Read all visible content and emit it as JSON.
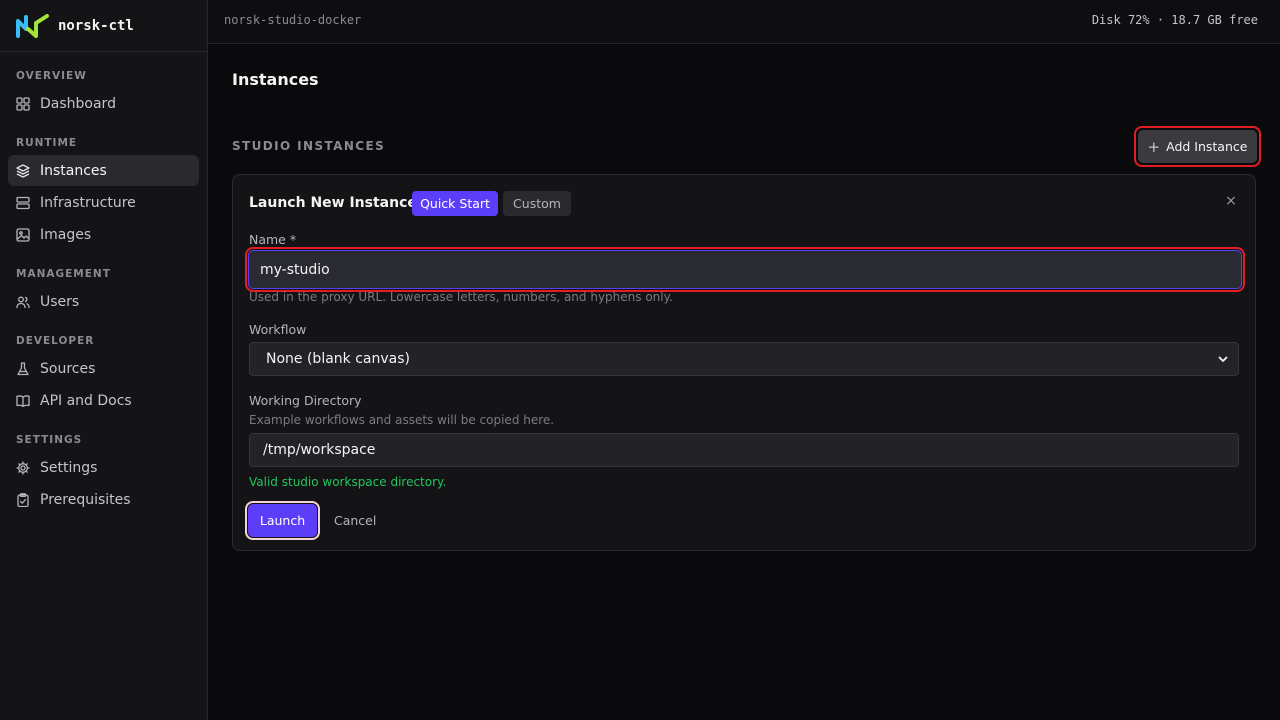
{
  "app": {
    "name": "norsk-ctl"
  },
  "topbar": {
    "host": "norsk-studio-docker",
    "disk": "Disk 72% · 18.7 GB free"
  },
  "sidebar": {
    "sections": [
      {
        "title": "OVERVIEW",
        "items": [
          {
            "label": "Dashboard",
            "icon": "grid-icon"
          }
        ]
      },
      {
        "title": "RUNTIME",
        "items": [
          {
            "label": "Instances",
            "icon": "layers-icon",
            "active": true
          },
          {
            "label": "Infrastructure",
            "icon": "server-icon"
          },
          {
            "label": "Images",
            "icon": "image-icon"
          }
        ]
      },
      {
        "title": "MANAGEMENT",
        "items": [
          {
            "label": "Users",
            "icon": "users-icon"
          }
        ]
      },
      {
        "title": "DEVELOPER",
        "items": [
          {
            "label": "Sources",
            "icon": "flask-icon"
          },
          {
            "label": "API and Docs",
            "icon": "book-icon"
          }
        ]
      },
      {
        "title": "SETTINGS",
        "items": [
          {
            "label": "Settings",
            "icon": "gear-icon"
          },
          {
            "label": "Prerequisites",
            "icon": "clipboard-check-icon"
          }
        ]
      }
    ]
  },
  "main": {
    "title": "Instances",
    "section_label": "STUDIO INSTANCES",
    "add_button": {
      "icon": "+",
      "label": "Add Instance"
    }
  },
  "panel": {
    "title": "Launch New Instance",
    "tabs": [
      {
        "label": "Quick Start",
        "active": true
      },
      {
        "label": "Custom",
        "active": false
      }
    ],
    "close": "×",
    "name": {
      "label": "Name *",
      "value": "my-studio",
      "hint": "Used in the proxy URL. Lowercase letters, numbers, and hyphens only."
    },
    "workflow": {
      "label": "Workflow",
      "selected": "None (blank canvas)"
    },
    "working_dir": {
      "label": "Working Directory",
      "hint": "Example workflows and assets will be copied here.",
      "value": "/tmp/workspace",
      "status": "Valid studio workspace directory."
    },
    "launch_label": "Launch",
    "cancel_label": "Cancel"
  },
  "colors": {
    "accent": "#5b3ff8",
    "success": "#22c55e",
    "highlight": "#e01e26"
  }
}
